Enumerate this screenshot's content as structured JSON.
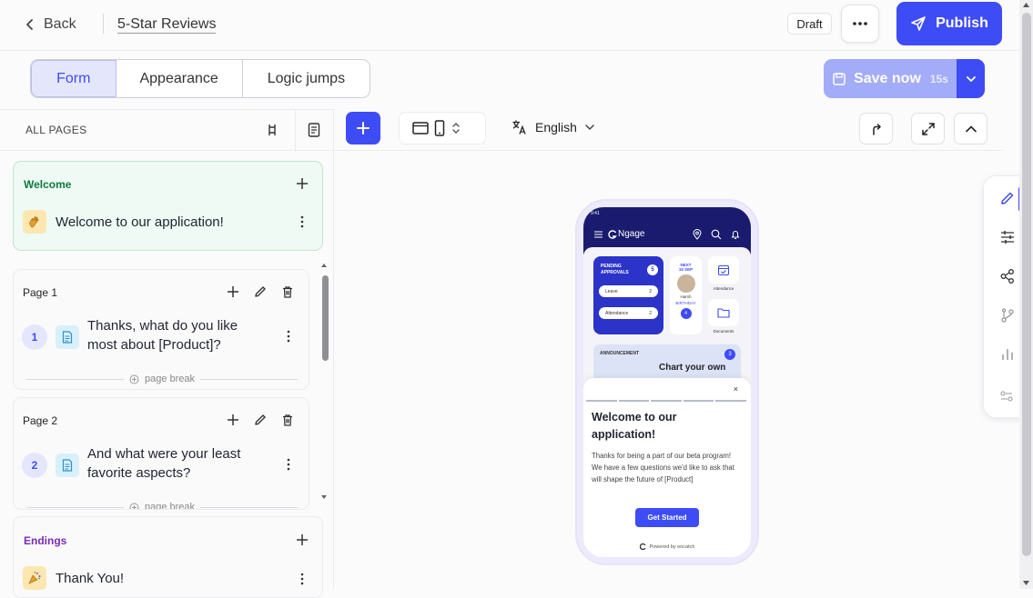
{
  "topbar": {
    "back_label": "Back",
    "breadcrumb": "5-Star Reviews",
    "status_badge": "Draft",
    "publish_label": "Publish"
  },
  "tabs": [
    {
      "label": "Form",
      "active": true
    },
    {
      "label": "Appearance",
      "active": false
    },
    {
      "label": "Logic jumps",
      "active": false
    }
  ],
  "save": {
    "label": "Save now",
    "time": "15s"
  },
  "sidebar": {
    "header": "ALL PAGES",
    "welcome": {
      "title": "Welcome",
      "item": "Welcome to our application!",
      "icon": "waving-hand-icon"
    },
    "pages": [
      {
        "title": "Page 1",
        "number": "1",
        "question": "Thanks, what do you like most about [Product]?"
      },
      {
        "title": "Page 2",
        "number": "2",
        "question": "And what were your least favorite aspects?"
      }
    ],
    "page_break_label": "page break",
    "endings": {
      "title": "Endings",
      "item": "Thank You!",
      "icon": "party-popper-icon"
    }
  },
  "toolbar": {
    "language": "English"
  },
  "preview": {
    "app_name": "Ngage",
    "status_time": "9:41",
    "pending_title": "PENDING APPROVALS",
    "pending_count": "5",
    "pending_items": [
      {
        "label": "Leave",
        "count": "2"
      },
      {
        "label": "Attendance",
        "count": "2"
      }
    ],
    "birthday": {
      "next": "NEXT",
      "date": "15 SEP",
      "name": "Harsh",
      "label": "BIRTHDAY",
      "count": "4"
    },
    "tiles": [
      {
        "label": "Attendance"
      },
      {
        "label": "Documents"
      }
    ],
    "announcement_title": "ANNOUNCEMENT",
    "announcement_count": "3",
    "announcement_text": "Chart your own",
    "modal": {
      "close": "×",
      "title": "Welcome to our application!",
      "description": "Thanks for being a part of our beta program! We have a few questions we'd like to ask that will shape the future of [Product]",
      "button": "Get Started",
      "powered": "Powered by encatch"
    }
  },
  "colors": {
    "accent": "#3d4cf5",
    "save_bg": "#a3acf8",
    "welcome_bg": "#eefaf3",
    "welcome_title": "#0f7a3d",
    "endings_title": "#7a2bb8"
  }
}
